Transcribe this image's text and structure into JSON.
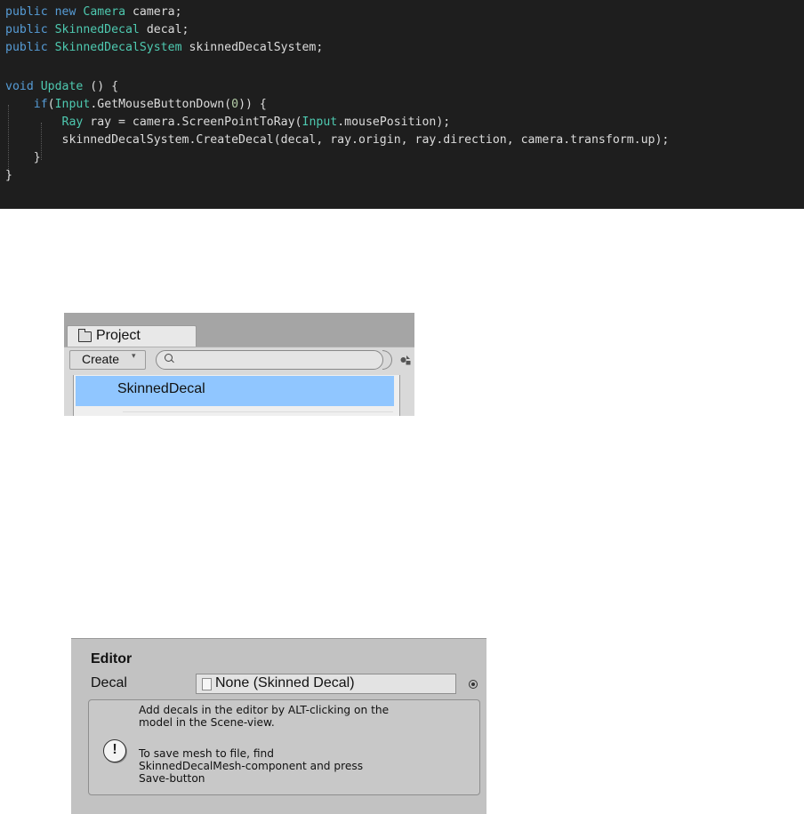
{
  "code": {
    "lines": [
      {
        "kw1": "public",
        "kw2": "new",
        "type": "Camera",
        "rest": " camera;"
      },
      {
        "kw1": "public",
        "type": "SkinnedDecal",
        "rest": " decal;"
      },
      {
        "kw1": "public",
        "type": "SkinnedDecalSystem",
        "rest": " skinnedDecalSystem;"
      },
      {
        "kw1": "void",
        "type": "Update",
        "rest": " () {"
      },
      {
        "kw1": "if",
        "punct": "(",
        "type": "Input",
        "rest": ".GetMouseButtonDown(",
        "num": "0",
        "rest2": ")) {"
      },
      {
        "type": "Ray",
        "rest": " ray = camera.ScreenPointToRay(",
        "type2": "Input",
        "rest2": ".mousePosition);"
      },
      {
        "rest": "skinnedDecalSystem.CreateDecal(decal, ray.origin, ray.direction, camera.transform.up);"
      },
      {
        "rest": "}"
      },
      {
        "rest": "}"
      }
    ]
  },
  "project": {
    "tab_label": "Project",
    "create_label": "Create",
    "create_arrow": "▾",
    "search_value": "",
    "selected_item": "SkinnedDecal",
    "icons": {
      "tab": "folder-icon",
      "search": "search-icon",
      "filter": "filter-by-type-icon"
    }
  },
  "inspector": {
    "header": "Editor",
    "decal_label": "Decal",
    "decal_value": "None (Skinned Decal)",
    "help_text_1": "Add decals in the editor by ALT-clicking on the\nmodel in the Scene-view.",
    "help_text_2": "To save mesh to file, find\nSkinnedDecalMesh-component and press\nSave-button",
    "info_glyph": "!",
    "icons": {
      "field": "document-icon",
      "picker": "object-picker-icon",
      "help": "info-icon"
    }
  }
}
